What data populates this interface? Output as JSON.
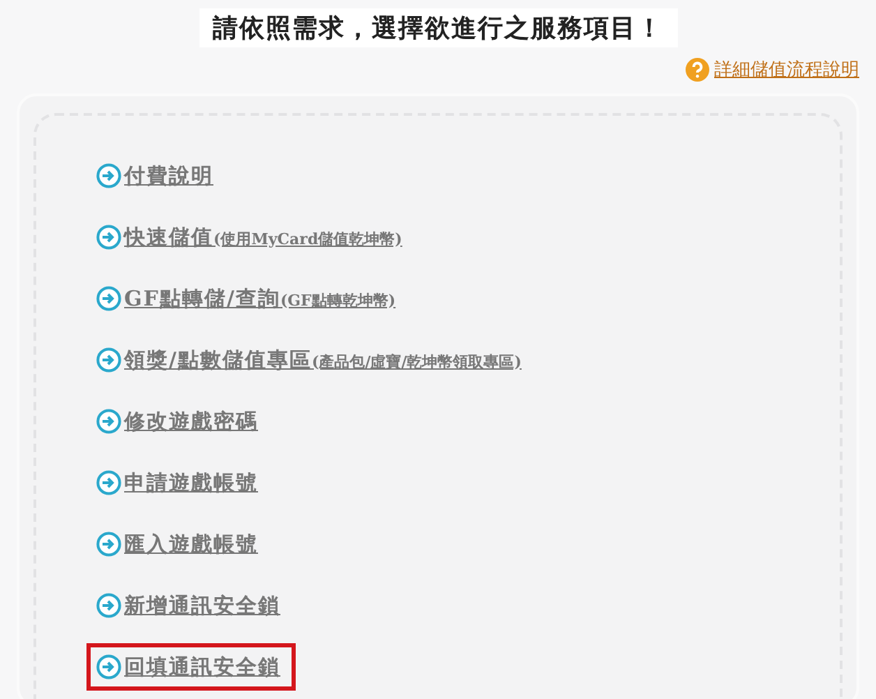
{
  "heading": "請依照需求，選擇欲進行之服務項目！",
  "help_link": "詳細儲值流程說明",
  "menu": [
    {
      "label": "付費說明",
      "highlighted": false
    },
    {
      "label": "快速儲值",
      "note": "(使用MyCard儲值乾坤幣)",
      "highlighted": false
    },
    {
      "label": "GF點轉儲/查詢",
      "note": "(GF點轉乾坤幣)",
      "highlighted": false
    },
    {
      "label": "領獎/點數儲值專區",
      "note": "(產品包/虛寶/乾坤幣領取專區)",
      "highlighted": false
    },
    {
      "label": "修改遊戲密碼",
      "highlighted": false
    },
    {
      "label": "申請遊戲帳號",
      "highlighted": false
    },
    {
      "label": "匯入遊戲帳號",
      "highlighted": false
    },
    {
      "label": "新增通訊安全鎖",
      "highlighted": false
    },
    {
      "label": "回填通訊安全鎖",
      "highlighted": true
    }
  ]
}
